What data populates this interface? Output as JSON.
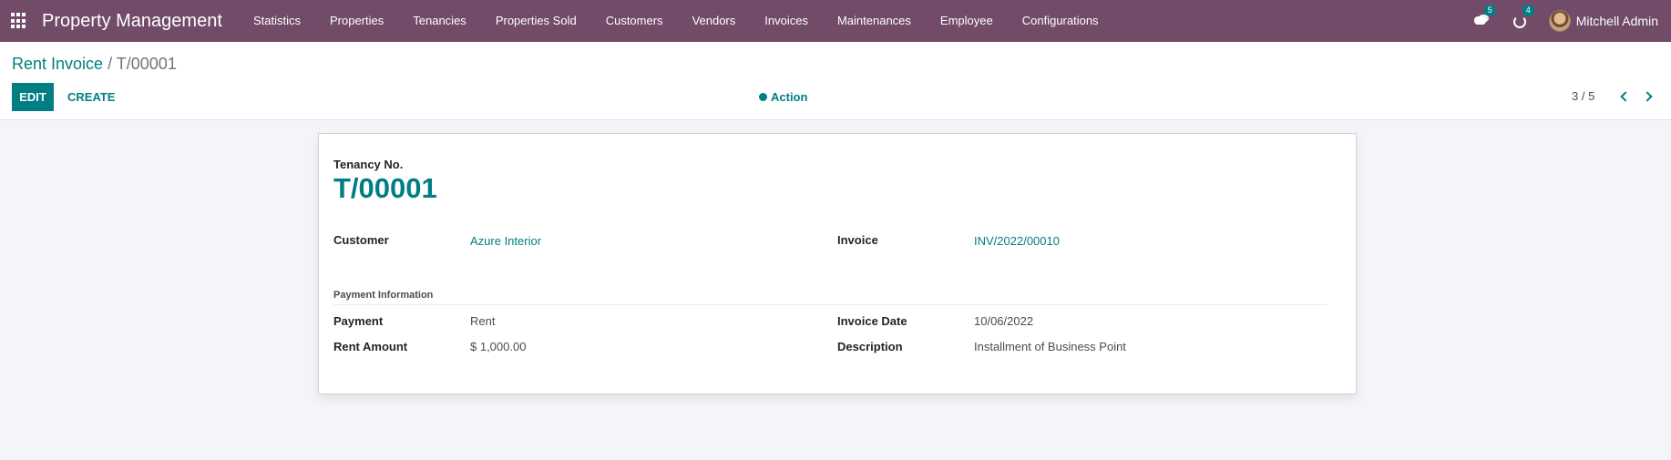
{
  "navbar": {
    "brand": "Property Management",
    "menu": [
      "Statistics",
      "Properties",
      "Tenancies",
      "Properties Sold",
      "Customers",
      "Vendors",
      "Invoices",
      "Maintenances",
      "Employee",
      "Configurations"
    ],
    "messages_count": "5",
    "activities_count": "4",
    "user_name": "Mitchell Admin",
    "color": "#714b67"
  },
  "control_panel": {
    "breadcrumb_parent": "Rent Invoice",
    "breadcrumb_separator": "/",
    "breadcrumb_current": "T/00001",
    "edit_label": "EDIT",
    "create_label": "CREATE",
    "action_label": "Action",
    "pager": "3 / 5"
  },
  "form": {
    "tenancy_label": "Tenancy No.",
    "tenancy_no": "T/00001",
    "customer_label": "Customer",
    "customer_value": "Azure Interior",
    "invoice_label": "Invoice",
    "invoice_value": "INV/2022/00010",
    "payment_info_title": "Payment Information",
    "payment_label": "Payment",
    "payment_value": "Rent",
    "rent_amount_label": "Rent Amount",
    "rent_amount_value": "$ 1,000.00",
    "invoice_date_label": "Invoice Date",
    "invoice_date_value": "10/06/2022",
    "description_label": "Description",
    "description_value": "Installment of Business Point"
  },
  "colors": {
    "accent": "#017e84",
    "navbar": "#714b67",
    "background": "#f4f5f9"
  },
  "icons": [
    "apps-grid-icon",
    "chat-icon",
    "activity-clock-icon",
    "gear-icon",
    "chevron-left-icon",
    "chevron-right-icon"
  ]
}
